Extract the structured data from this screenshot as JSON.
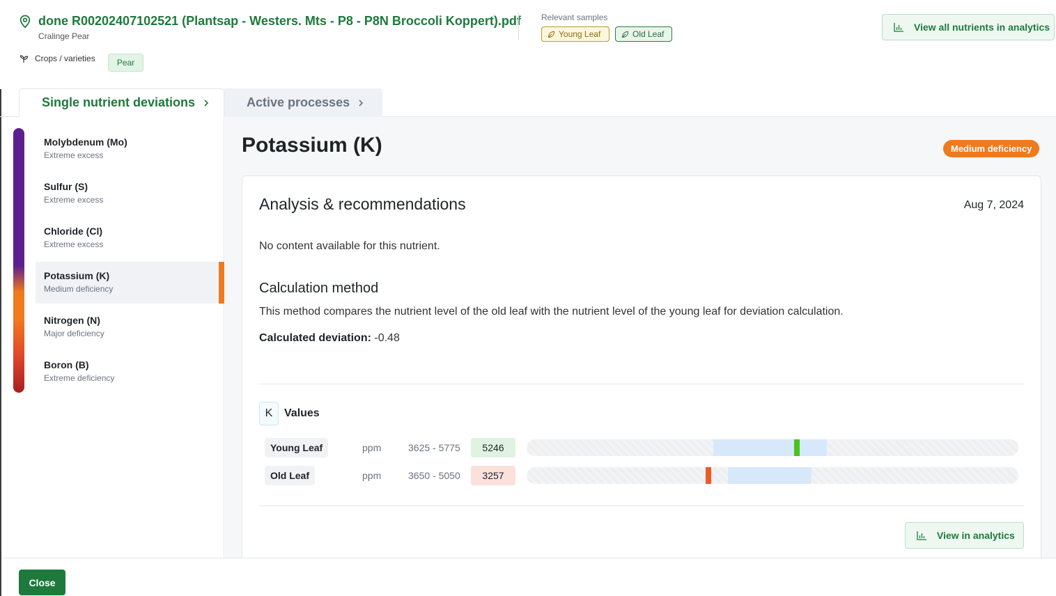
{
  "header": {
    "file_title": "done R00202407102521 (Plantsap - Westers. Mts - P8 - P8N Broccoli Koppert).pdf",
    "subtitle": "Cralinge Pear",
    "relevant_samples_label": "Relevant samples",
    "samples": [
      "Young Leaf",
      "Old Leaf"
    ],
    "analytics_button": "View all nutrients in analytics",
    "crops_label": "Crops / varieties",
    "crop": "Pear"
  },
  "tabs": [
    {
      "label": "Single nutrient deviations",
      "active": true
    },
    {
      "label": "Active processes",
      "active": false
    }
  ],
  "sidebar": {
    "items": [
      {
        "name": "Molybdenum (Mo)",
        "status": "Extreme excess"
      },
      {
        "name": "Sulfur (S)",
        "status": "Extreme excess"
      },
      {
        "name": "Chloride (Cl)",
        "status": "Extreme excess"
      },
      {
        "name": "Potassium (K)",
        "status": "Medium deficiency",
        "active": true
      },
      {
        "name": "Nitrogen (N)",
        "status": "Major deficiency"
      },
      {
        "name": "Boron (B)",
        "status": "Extreme deficiency"
      }
    ]
  },
  "main": {
    "title": "Potassium (K)",
    "severity": "Medium deficiency",
    "severity_color": "#f07a1e",
    "card": {
      "title": "Analysis & recommendations",
      "date": "Aug 7, 2024",
      "no_content": "No content available for this nutrient.",
      "calc_title": "Calculation method",
      "calc_desc": "This method compares the nutrient level of the old leaf with the nutrient level of the young leaf for deviation calculation.",
      "calc_dev_label": "Calculated deviation:",
      "calc_dev_value": "-0.48",
      "values_symbol": "K",
      "values_label": "Values",
      "rows": [
        {
          "sample": "Young Leaf",
          "unit": "ppm",
          "range": "3625 - 5775",
          "value": "5246",
          "status": "good"
        },
        {
          "sample": "Old Leaf",
          "unit": "ppm",
          "range": "3650 - 5050",
          "value": "3257",
          "status": "bad"
        }
      ],
      "view_button": "View in analytics"
    }
  },
  "footer": {
    "close_button": "Close"
  }
}
